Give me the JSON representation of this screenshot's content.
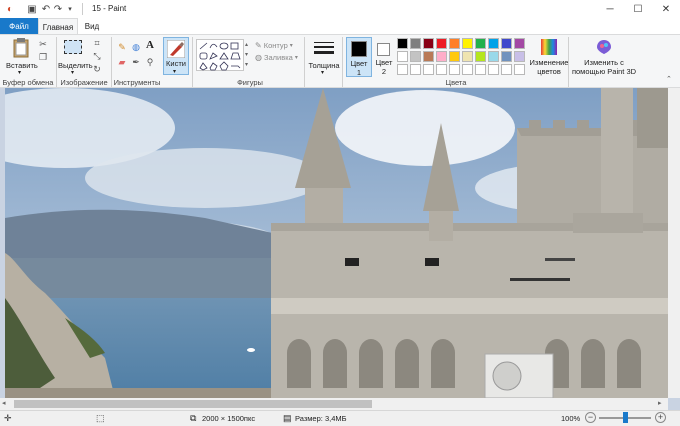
{
  "window": {
    "title": "15 - Paint"
  },
  "tabs": {
    "file": "Файл",
    "home": "Главная",
    "view": "Вид"
  },
  "ribbon": {
    "clipboard": {
      "paste": "Вставить",
      "group": "Буфер обмена"
    },
    "image": {
      "select": "Выделить",
      "group": "Изображение"
    },
    "tools": {
      "group": "Инструменты"
    },
    "brushes": {
      "label": "Кисти"
    },
    "shapes": {
      "outline": "Контур",
      "fill": "Заливка",
      "group": "Фигуры"
    },
    "size": {
      "label": "Толщина"
    },
    "colors": {
      "color1_line1": "Цвет",
      "color1_line2": "1",
      "color2_line1": "Цвет",
      "color2_line2": "2",
      "edit_line1": "Изменение",
      "edit_line2": "цветов",
      "group": "Цвета",
      "color1": "#000000",
      "color2": "#ffffff",
      "palette_row1": [
        "#000000",
        "#7f7f7f",
        "#880015",
        "#ed1c24",
        "#ff7f27",
        "#fff200",
        "#22b14c",
        "#00a2e8",
        "#3f48cc",
        "#a349a4"
      ],
      "palette_row2": [
        "#ffffff",
        "#c3c3c3",
        "#b97a57",
        "#ffaec9",
        "#ffc90e",
        "#efe4b0",
        "#b5e61d",
        "#99d9ea",
        "#7092be",
        "#c8bfe7"
      ]
    },
    "paint3d": {
      "line1": "Изменить с",
      "line2": "помощью Paint 3D"
    }
  },
  "status": {
    "dimensions": "2000 × 1500пкс",
    "size": "Размер: 3,4МБ",
    "zoom": "100%",
    "zoom_level": 0.5
  },
  "colors": {
    "accent": "#1979ca",
    "sky": "#9cb7d6",
    "stone": "#b5b1a8"
  }
}
